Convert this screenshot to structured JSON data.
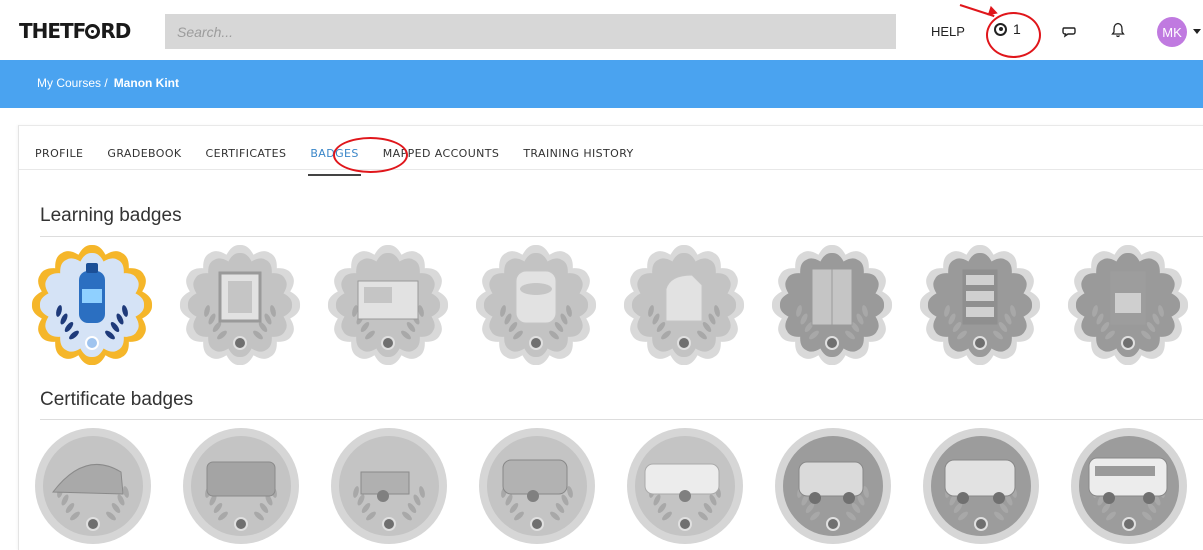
{
  "header": {
    "logo_text_a": "THETF",
    "logo_text_b": "RD",
    "search_placeholder": "Search...",
    "help_label": "HELP",
    "notification_count": "1",
    "avatar_initials": "MK"
  },
  "breadcrumb": {
    "parent": "My Courses /",
    "current": "Manon Kint"
  },
  "tabs": [
    {
      "label": "PROFILE",
      "active": false
    },
    {
      "label": "GRADEBOOK",
      "active": false
    },
    {
      "label": "CERTIFICATES",
      "active": false
    },
    {
      "label": "BADGES",
      "active": true
    },
    {
      "label": "MAPPED ACCOUNTS",
      "active": false
    },
    {
      "label": "TRAINING HISTORY",
      "active": false
    }
  ],
  "sections": {
    "learning_title": "Learning badges",
    "certificate_title": "Certificate badges"
  },
  "learning_badges": [
    {
      "item": "toilet-fluid-bottle",
      "earned": true
    },
    {
      "item": "door-frame",
      "earned": false
    },
    {
      "item": "product-box",
      "earned": false
    },
    {
      "item": "cassette-toilet",
      "earned": false
    },
    {
      "item": "portable-toilet",
      "earned": false
    },
    {
      "item": "refrigerator",
      "earned": false
    },
    {
      "item": "stocked-fridge",
      "earned": false
    },
    {
      "item": "cooker-oven",
      "earned": false
    }
  ],
  "certificate_badges": [
    {
      "item": "tent"
    },
    {
      "item": "awning"
    },
    {
      "item": "trailer"
    },
    {
      "item": "caravan"
    },
    {
      "item": "large-caravan"
    },
    {
      "item": "camper-van"
    },
    {
      "item": "motorhome"
    },
    {
      "item": "coach-motorhome"
    }
  ],
  "colors": {
    "brand_blue": "#4aa3f0",
    "earned_gold": "#f5b62a",
    "earned_navy": "#1e3a7a",
    "locked_grey": "#bdbdbd",
    "annotation_red": "#e0161b",
    "avatar_purple": "#c07ae0"
  }
}
